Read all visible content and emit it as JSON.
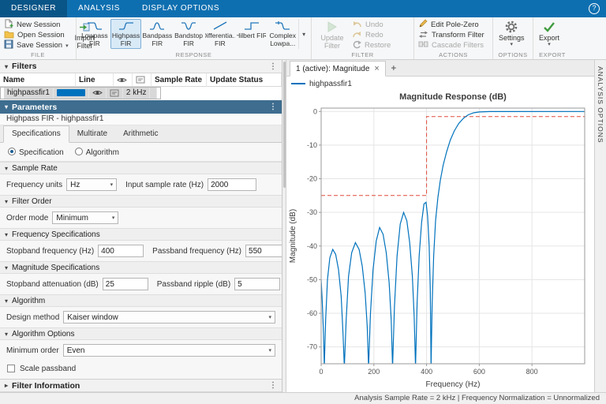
{
  "icons": {
    "caret_down": "▾",
    "caret_right": "▸",
    "dots": "⋮",
    "dropdown": "▾",
    "close": "×",
    "plus": "+",
    "help": "?"
  },
  "colors": {
    "accent": "#0072BD",
    "mask_red": "#E04A3A",
    "tabstrip_blue": "#0e6fb0",
    "active_tab_blue": "#0a5587",
    "params_header_blue": "#3e6d8f"
  },
  "app": {
    "tabs": [
      {
        "label": "DESIGNER"
      },
      {
        "label": "ANALYSIS"
      },
      {
        "label": "DISPLAY OPTIONS"
      }
    ]
  },
  "ribbon": {
    "file": {
      "group": "FILE",
      "new_session": "New Session",
      "open_session": "Open Session",
      "save_session": "Save Session",
      "import_l1": "Import",
      "import_l2": "Filter"
    },
    "response": {
      "group": "RESPONSE",
      "items": [
        {
          "l1": "Lowpass",
          "l2": "FIR"
        },
        {
          "l1": "Highpass",
          "l2": "FIR"
        },
        {
          "l1": "Bandpass",
          "l2": "FIR"
        },
        {
          "l1": "Bandstop",
          "l2": "FIR"
        },
        {
          "l1": "Differentia...",
          "l2": "FIR"
        },
        {
          "l1": "Hilbert FIR",
          "l2": ""
        },
        {
          "l1": "Complex",
          "l2": "Lowpa..."
        }
      ]
    },
    "filter": {
      "group": "FILTER",
      "update_l1": "Update",
      "update_l2": "Filter",
      "undo": "Undo",
      "redo": "Redo",
      "restore": "Restore"
    },
    "actions": {
      "group": "ACTIONS",
      "edit_pole_zero": "Edit Pole-Zero",
      "transform_filter": "Transform Filter",
      "cascade_filters": "Cascade Filters"
    },
    "options": {
      "group": "OPTIONS",
      "settings": "Settings"
    },
    "export": {
      "group": "EXPORT",
      "export": "Export"
    }
  },
  "filters_panel": {
    "title": "Filters",
    "columns": {
      "name": "Name",
      "line": "Line",
      "sample_rate": "Sample Rate",
      "update_status": "Update Status"
    },
    "row": {
      "name": "highpassfir1",
      "sample_rate": "2 kHz",
      "update_status": ""
    }
  },
  "params": {
    "header": "Parameters",
    "subtitle": "Highpass FIR - highpassfir1",
    "tabs": [
      "Specifications",
      "Multirate",
      "Arithmetic"
    ],
    "radio_spec": "Specification",
    "radio_algo": "Algorithm",
    "sample_rate": {
      "title": "Sample Rate",
      "freq_units_label": "Frequency units",
      "freq_units_value": "Hz",
      "rate_label": "Input sample rate (Hz)",
      "rate_value": "2000"
    },
    "filter_order": {
      "title": "Filter Order",
      "order_mode_label": "Order mode",
      "order_mode_value": "Minimum"
    },
    "freq_specs": {
      "title": "Frequency Specifications",
      "stop_label": "Stopband frequency (Hz)",
      "stop_value": "400",
      "pass_label": "Passband frequency (Hz)",
      "pass_value": "550"
    },
    "mag_specs": {
      "title": "Magnitude Specifications",
      "atten_label": "Stopband attenuation (dB)",
      "atten_value": "25",
      "ripple_label": "Passband ripple (dB)",
      "ripple_value": "5"
    },
    "algorithm": {
      "title": "Algorithm",
      "design_label": "Design method",
      "design_value": "Kaiser window"
    },
    "algo_options": {
      "title": "Algorithm Options",
      "min_order_label": "Minimum order",
      "min_order_value": "Even",
      "scale_label": "Scale passband"
    },
    "filter_info": "Filter Information"
  },
  "doc": {
    "tab_label": "1 (active): Magnitude",
    "legend": "highpassfir1",
    "analysis_options": "ANALYSIS OPTIONS"
  },
  "status_bar": {
    "text": "Analysis Sample Rate = 2 kHz | Frequency Normalization = Unnormalized"
  },
  "chart_data": {
    "type": "line",
    "title": "Magnitude Response (dB)",
    "xlabel": "Frequency (Hz)",
    "ylabel": "Magnitude (dB)",
    "xlim": [
      0,
      1000
    ],
    "ylim": [
      -75,
      1
    ],
    "xticks": [
      0,
      200,
      400,
      600,
      800
    ],
    "yticks": [
      0,
      -10,
      -20,
      -30,
      -40,
      -50,
      -60,
      -70
    ],
    "grid": true,
    "legend_position": "top-left",
    "series": [
      {
        "name": "highpassfir1",
        "color": "#0072BD",
        "points": [
          [
            0,
            -50
          ],
          [
            4,
            -56
          ],
          [
            9,
            -66
          ],
          [
            12,
            -76
          ],
          [
            17,
            -62
          ],
          [
            24,
            -50
          ],
          [
            33,
            -43.5
          ],
          [
            44,
            -41
          ],
          [
            55,
            -42.5
          ],
          [
            66,
            -47
          ],
          [
            76,
            -55
          ],
          [
            83,
            -66
          ],
          [
            88,
            -76
          ],
          [
            95,
            -62
          ],
          [
            104,
            -49
          ],
          [
            116,
            -42
          ],
          [
            130,
            -39
          ],
          [
            144,
            -41
          ],
          [
            156,
            -46
          ],
          [
            167,
            -54
          ],
          [
            175,
            -64
          ],
          [
            180,
            -76
          ],
          [
            187,
            -60
          ],
          [
            197,
            -47
          ],
          [
            209,
            -38.5
          ],
          [
            222,
            -34.5
          ],
          [
            235,
            -36.5
          ],
          [
            247,
            -42
          ],
          [
            258,
            -51
          ],
          [
            266,
            -62
          ],
          [
            271,
            -76
          ],
          [
            278,
            -58
          ],
          [
            288,
            -43
          ],
          [
            300,
            -33.5
          ],
          [
            313,
            -30
          ],
          [
            325,
            -32.5
          ],
          [
            336,
            -39
          ],
          [
            346,
            -49
          ],
          [
            353,
            -61
          ],
          [
            358,
            -76
          ],
          [
            364,
            -57
          ],
          [
            372,
            -43
          ],
          [
            381,
            -33
          ],
          [
            390,
            -27.5
          ],
          [
            398,
            -27
          ],
          [
            404,
            -31
          ],
          [
            410,
            -40
          ],
          [
            414,
            -53
          ],
          [
            417,
            -76
          ],
          [
            421,
            -58
          ],
          [
            427,
            -43
          ],
          [
            434,
            -32.5
          ],
          [
            443,
            -25.5
          ],
          [
            452,
            -20.5
          ],
          [
            463,
            -16
          ],
          [
            476,
            -12
          ],
          [
            490,
            -8.5
          ],
          [
            505,
            -5.8
          ],
          [
            522,
            -3.6
          ],
          [
            540,
            -2
          ],
          [
            558,
            -1
          ],
          [
            578,
            -0.4
          ],
          [
            600,
            -0.15
          ],
          [
            640,
            -0.03
          ],
          [
            1000,
            0
          ]
        ]
      }
    ],
    "mask": {
      "name": "design-mask",
      "color": "#E04A3A",
      "style": "dashed",
      "points": [
        [
          0,
          -25
        ],
        [
          400,
          -25
        ],
        [
          400,
          -1.5
        ],
        [
          1000,
          -1.5
        ]
      ]
    }
  }
}
